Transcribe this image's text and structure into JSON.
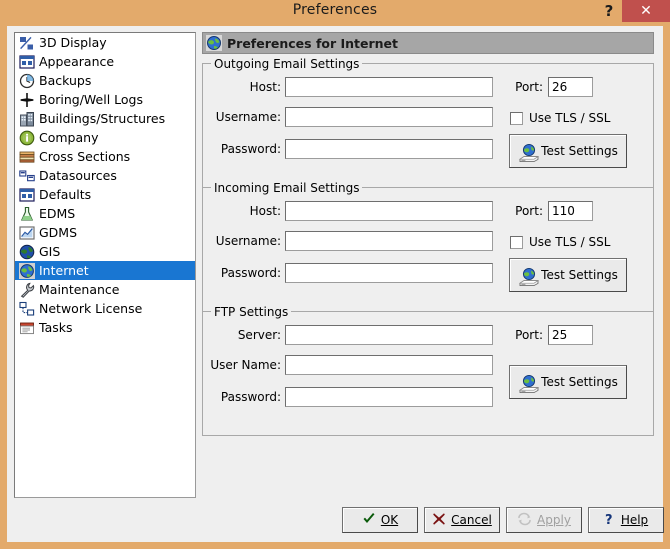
{
  "window": {
    "title": "Preferences",
    "help_glyph": "?",
    "close_glyph": "✕",
    "titlebar_color": "#e3aa6b",
    "close_color": "#c0504d"
  },
  "sidebar": {
    "items": [
      {
        "label": "3D Display",
        "icon": "cube-icon",
        "selected": false
      },
      {
        "label": "Appearance",
        "icon": "window-icon",
        "selected": false
      },
      {
        "label": "Backups",
        "icon": "clock-icon",
        "selected": false
      },
      {
        "label": "Boring/Well Logs",
        "icon": "star-icon",
        "selected": false
      },
      {
        "label": "Buildings/Structures",
        "icon": "building-icon",
        "selected": false
      },
      {
        "label": "Company",
        "icon": "info-globe-icon",
        "selected": false
      },
      {
        "label": "Cross Sections",
        "icon": "strata-icon",
        "selected": false
      },
      {
        "label": "Datasources",
        "icon": "database-icon",
        "selected": false
      },
      {
        "label": "Defaults",
        "icon": "window-icon",
        "selected": false
      },
      {
        "label": "EDMS",
        "icon": "flask-icon",
        "selected": false
      },
      {
        "label": "GDMS",
        "icon": "chart-icon",
        "selected": false
      },
      {
        "label": "GIS",
        "icon": "globe-icon",
        "selected": false
      },
      {
        "label": "Internet",
        "icon": "globe-web-icon",
        "selected": true
      },
      {
        "label": "Maintenance",
        "icon": "wrench-icon",
        "selected": false
      },
      {
        "label": "Network License",
        "icon": "network-icon",
        "selected": false
      },
      {
        "label": "Tasks",
        "icon": "tasks-icon",
        "selected": false
      }
    ],
    "selection_color": "#1976d2"
  },
  "pane": {
    "header_title": "Preferences for Internet",
    "header_icon": "globe-web-icon",
    "header_color": "#a6a6a6"
  },
  "groups": {
    "outgoing": {
      "title": "Outgoing Email Settings",
      "host_label": "Host:",
      "host_value": "",
      "username_label": "Username:",
      "username_value": "",
      "password_label": "Password:",
      "password_value": "",
      "port_label": "Port:",
      "port_value": "26",
      "tls_label": "Use TLS / SSL",
      "tls_checked": false,
      "test_label": "Test Settings",
      "test_icon": "globe-modem-icon"
    },
    "incoming": {
      "title": "Incoming Email Settings",
      "host_label": "Host:",
      "host_value": "",
      "username_label": "Username:",
      "username_value": "",
      "password_label": "Password:",
      "password_value": "",
      "port_label": "Port:",
      "port_value": "110",
      "tls_label": "Use TLS / SSL",
      "tls_checked": false,
      "test_label": "Test Settings",
      "test_icon": "globe-modem-icon"
    },
    "ftp": {
      "title": "FTP Settings",
      "server_label": "Server:",
      "server_value": "",
      "username_label": "User Name:",
      "username_value": "",
      "password_label": "Password:",
      "password_value": "",
      "port_label": "Port:",
      "port_value": "25",
      "test_label": "Test Settings",
      "test_icon": "globe-modem-icon"
    }
  },
  "footer": {
    "ok": {
      "label": "OK",
      "icon": "check-icon",
      "enabled": true
    },
    "cancel": {
      "label": "Cancel",
      "icon": "cross-icon",
      "enabled": true
    },
    "apply": {
      "label": "Apply",
      "icon": "refresh-icon",
      "enabled": false
    },
    "help": {
      "label": "Help",
      "icon": "question-icon",
      "enabled": true
    }
  }
}
